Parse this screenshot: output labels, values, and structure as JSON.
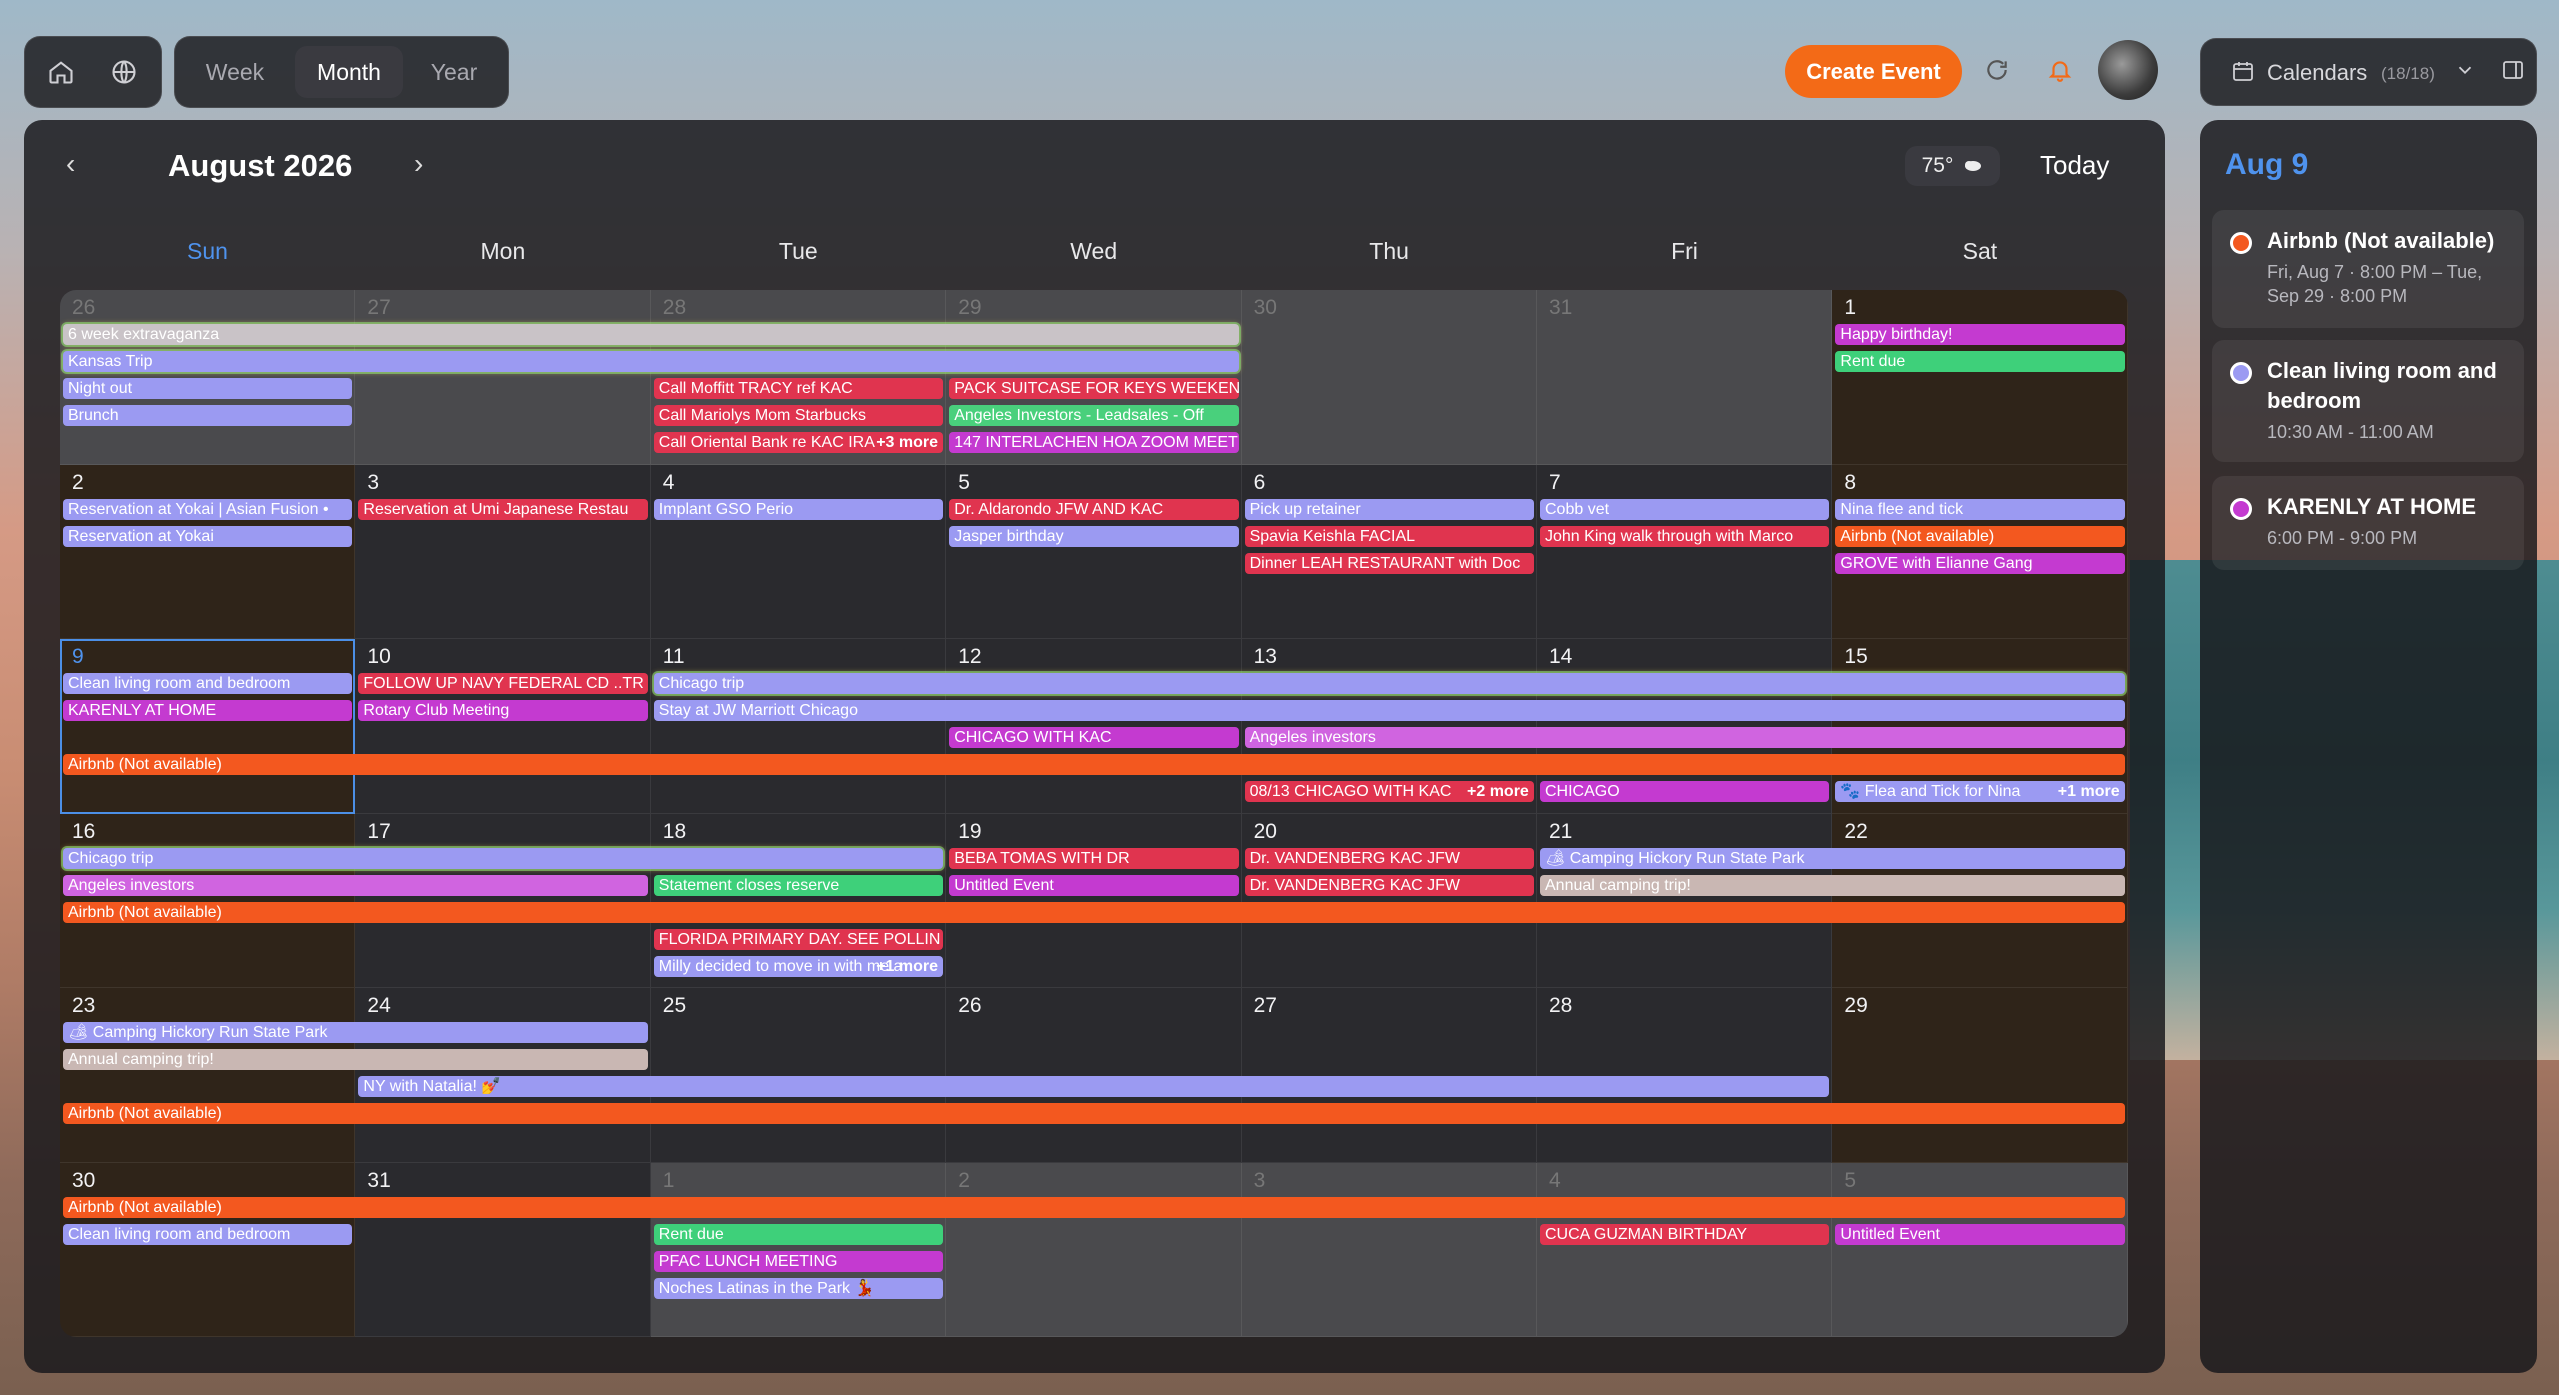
{
  "toolbar": {
    "views": [
      "Week",
      "Month",
      "Year"
    ],
    "active_view": "Month",
    "create_label": "Create Event",
    "calendars_label": "Calendars",
    "calendars_count": "(18/18)"
  },
  "calendar": {
    "title": "August 2026",
    "weather": "75°",
    "today_label": "Today",
    "weekdays": [
      "Sun",
      "Mon",
      "Tue",
      "Wed",
      "Thu",
      "Fri",
      "Sat"
    ],
    "weeks": [
      [
        "26",
        "27",
        "28",
        "29",
        "30",
        "31",
        "1"
      ],
      [
        "2",
        "3",
        "4",
        "5",
        "6",
        "7",
        "8"
      ],
      [
        "9",
        "10",
        "11",
        "12",
        "13",
        "14",
        "15"
      ],
      [
        "16",
        "17",
        "18",
        "19",
        "20",
        "21",
        "22"
      ],
      [
        "23",
        "24",
        "25",
        "26",
        "27",
        "28",
        "29"
      ],
      [
        "30",
        "31",
        "1",
        "2",
        "3",
        "4",
        "5"
      ]
    ],
    "events": [
      {
        "w": 0,
        "c": 0,
        "span": 4,
        "row": 0,
        "text": "6 week extravaganza",
        "color": "#c9c3c7",
        "glow": true
      },
      {
        "w": 0,
        "c": 0,
        "span": 4,
        "row": 1,
        "text": "Kansas Trip",
        "color": "#9b9af2",
        "glow": true
      },
      {
        "w": 0,
        "c": 0,
        "span": 1,
        "row": 2,
        "text": "Night out",
        "color": "#9b9af2"
      },
      {
        "w": 0,
        "c": 0,
        "span": 1,
        "row": 3,
        "text": "Brunch",
        "color": "#9b9af2"
      },
      {
        "w": 0,
        "c": 2,
        "span": 1,
        "row": 2,
        "text": "Call Moffitt TRACY ref KAC",
        "color": "#e0344f"
      },
      {
        "w": 0,
        "c": 2,
        "span": 1,
        "row": 3,
        "text": "Call Mariolys Mom Starbucks",
        "color": "#e0344f"
      },
      {
        "w": 0,
        "c": 2,
        "span": 1,
        "row": 4,
        "text": "Call Oriental Bank re KAC IRA",
        "color": "#e0344f"
      },
      {
        "w": 0,
        "c": 3,
        "span": 1,
        "row": 2,
        "text": "PACK SUITCASE FOR KEYS WEEKEN",
        "color": "#e0344f"
      },
      {
        "w": 0,
        "c": 3,
        "span": 1,
        "row": 3,
        "text": "Angeles Investors - Leadsales - Off",
        "color": "#49d07c"
      },
      {
        "w": 0,
        "c": 3,
        "span": 1,
        "row": 4,
        "text": "147 INTERLACHEN HOA ZOOM MEET",
        "color": "#c43ad0"
      },
      {
        "w": 0,
        "c": 6,
        "span": 1,
        "row": 0,
        "text": "Happy birthday!",
        "color": "#c43ad0"
      },
      {
        "w": 0,
        "c": 6,
        "span": 1,
        "row": 1,
        "text": "Rent due",
        "color": "#3ed07a"
      },
      {
        "w": 1,
        "c": 0,
        "span": 1,
        "row": 0,
        "text": "Reservation at Yokai | Asian Fusion •",
        "color": "#9b9af2"
      },
      {
        "w": 1,
        "c": 0,
        "span": 1,
        "row": 1,
        "text": "Reservation at Yokai",
        "color": "#9b9af2"
      },
      {
        "w": 1,
        "c": 1,
        "span": 1,
        "row": 0,
        "text": "Reservation at Umi Japanese Restau",
        "color": "#e0344f"
      },
      {
        "w": 1,
        "c": 2,
        "span": 1,
        "row": 0,
        "text": "Implant GSO Perio",
        "color": "#9b9af2"
      },
      {
        "w": 1,
        "c": 3,
        "span": 1,
        "row": 0,
        "text": "Dr. Aldarondo JFW AND KAC",
        "color": "#e0344f"
      },
      {
        "w": 1,
        "c": 3,
        "span": 1,
        "row": 1,
        "text": "Jasper birthday",
        "color": "#9b9af2"
      },
      {
        "w": 1,
        "c": 4,
        "span": 1,
        "row": 0,
        "text": "Pick up retainer",
        "color": "#9b9af2"
      },
      {
        "w": 1,
        "c": 4,
        "span": 1,
        "row": 1,
        "text": "Spavia Keishla FACIAL",
        "color": "#e0344f"
      },
      {
        "w": 1,
        "c": 4,
        "span": 1,
        "row": 2,
        "text": "Dinner LEAH RESTAURANT with Doc",
        "color": "#e0344f"
      },
      {
        "w": 1,
        "c": 5,
        "span": 1,
        "row": 0,
        "text": "Cobb vet",
        "color": "#9b9af2"
      },
      {
        "w": 1,
        "c": 5,
        "span": 1,
        "row": 1,
        "text": "John King walk through with Marco",
        "color": "#e0344f"
      },
      {
        "w": 1,
        "c": 6,
        "span": 1,
        "row": 0,
        "text": "Nina flee and tick",
        "color": "#9b9af2"
      },
      {
        "w": 1,
        "c": 6,
        "span": 1,
        "row": 1,
        "text": "Airbnb (Not available)",
        "color": "#f3581f"
      },
      {
        "w": 1,
        "c": 6,
        "span": 1,
        "row": 2,
        "text": "GROVE with Elianne Gang",
        "color": "#c43ad0"
      },
      {
        "w": 2,
        "c": 0,
        "span": 1,
        "row": 0,
        "text": "Clean living room and bedroom",
        "color": "#9b9af2"
      },
      {
        "w": 2,
        "c": 0,
        "span": 1,
        "row": 1,
        "text": "KARENLY AT HOME",
        "color": "#c43ad0"
      },
      {
        "w": 2,
        "c": 0,
        "span": 7,
        "row": 3,
        "text": "Airbnb (Not available)",
        "color": "#f3581f"
      },
      {
        "w": 2,
        "c": 1,
        "span": 1,
        "row": 0,
        "text": "FOLLOW UP NAVY FEDERAL CD ..TR",
        "color": "#e0344f"
      },
      {
        "w": 2,
        "c": 1,
        "span": 1,
        "row": 1,
        "text": "Rotary Club Meeting",
        "color": "#c43ad0"
      },
      {
        "w": 2,
        "c": 2,
        "span": 5,
        "row": 0,
        "text": "Chicago trip",
        "color": "#9b9af2",
        "glow": true
      },
      {
        "w": 2,
        "c": 2,
        "span": 5,
        "row": 1,
        "text": "Stay at JW Marriott Chicago",
        "color": "#9b9af2"
      },
      {
        "w": 2,
        "c": 3,
        "span": 1,
        "row": 2,
        "text": "CHICAGO WITH KAC",
        "color": "#c43ad0"
      },
      {
        "w": 2,
        "c": 4,
        "span": 3,
        "row": 2,
        "text": "Angeles investors",
        "color": "#d064e0"
      },
      {
        "w": 2,
        "c": 4,
        "span": 1,
        "row": 4,
        "text": "08/13 CHICAGO WITH KAC",
        "color": "#e0344f"
      },
      {
        "w": 2,
        "c": 5,
        "span": 1,
        "row": 4,
        "text": "CHICAGO",
        "color": "#c43ad0"
      },
      {
        "w": 2,
        "c": 6,
        "span": 1,
        "row": 4,
        "text": "🐾 Flea and Tick for Nina",
        "color": "#9b9af2"
      },
      {
        "w": 3,
        "c": 0,
        "span": 3,
        "row": 0,
        "text": "Chicago trip",
        "color": "#9b9af2",
        "glow": true
      },
      {
        "w": 3,
        "c": 0,
        "span": 2,
        "row": 1,
        "text": "Angeles investors",
        "color": "#d064e0"
      },
      {
        "w": 3,
        "c": 0,
        "span": 7,
        "row": 2,
        "text": "Airbnb (Not available)",
        "color": "#f3581f"
      },
      {
        "w": 3,
        "c": 2,
        "span": 1,
        "row": 1,
        "text": "Statement closes reserve",
        "color": "#3ed07a"
      },
      {
        "w": 3,
        "c": 2,
        "span": 1,
        "row": 3,
        "text": "FLORIDA PRIMARY DAY. SEE POLLIN",
        "color": "#e0344f"
      },
      {
        "w": 3,
        "c": 2,
        "span": 1,
        "row": 4,
        "text": "Milly decided to move in with me a",
        "color": "#9b9af2"
      },
      {
        "w": 3,
        "c": 3,
        "span": 1,
        "row": 0,
        "text": "BEBA TOMAS WITH DR",
        "color": "#e0344f"
      },
      {
        "w": 3,
        "c": 3,
        "span": 1,
        "row": 1,
        "text": "Untitled Event",
        "color": "#c43ad0"
      },
      {
        "w": 3,
        "c": 4,
        "span": 1,
        "row": 0,
        "text": "Dr. VANDENBERG KAC JFW",
        "color": "#e0344f"
      },
      {
        "w": 3,
        "c": 4,
        "span": 1,
        "row": 1,
        "text": "Dr. VANDENBERG KAC JFW",
        "color": "#e0344f"
      },
      {
        "w": 3,
        "c": 5,
        "span": 2,
        "row": 0,
        "text": "🏕 Camping Hickory Run State Park",
        "color": "#9b9af2"
      },
      {
        "w": 3,
        "c": 5,
        "span": 2,
        "row": 1,
        "text": "Annual camping trip!",
        "color": "#c9b7b3"
      },
      {
        "w": 4,
        "c": 0,
        "span": 2,
        "row": 0,
        "text": "🏕 Camping Hickory Run State Park",
        "color": "#9b9af2"
      },
      {
        "w": 4,
        "c": 0,
        "span": 2,
        "row": 1,
        "text": "Annual camping trip!",
        "color": "#c9b7b3"
      },
      {
        "w": 4,
        "c": 1,
        "span": 5,
        "row": 2,
        "text": "NY with Natalia! 💅",
        "color": "#9b9af2"
      },
      {
        "w": 4,
        "c": 0,
        "span": 7,
        "row": 3,
        "text": "Airbnb (Not available)",
        "color": "#f3581f"
      },
      {
        "w": 5,
        "c": 0,
        "span": 7,
        "row": 0,
        "text": "Airbnb (Not available)",
        "color": "#f3581f"
      },
      {
        "w": 5,
        "c": 0,
        "span": 1,
        "row": 1,
        "text": "Clean living room and bedroom",
        "color": "#9b9af2"
      },
      {
        "w": 5,
        "c": 2,
        "span": 1,
        "row": 1,
        "text": "Rent due",
        "color": "#3ed07a"
      },
      {
        "w": 5,
        "c": 2,
        "span": 1,
        "row": 2,
        "text": "PFAC LUNCH MEETING",
        "color": "#c43ad0"
      },
      {
        "w": 5,
        "c": 2,
        "span": 1,
        "row": 3,
        "text": "Noches Latinas in the Park 💃",
        "color": "#9b9af2"
      },
      {
        "w": 5,
        "c": 5,
        "span": 1,
        "row": 1,
        "text": "CUCA GUZMAN BIRTHDAY",
        "color": "#e0344f"
      },
      {
        "w": 5,
        "c": 6,
        "span": 1,
        "row": 1,
        "text": "Untitled Event",
        "color": "#c43ad0"
      }
    ],
    "more": [
      {
        "w": 0,
        "c": 2,
        "row": 4,
        "text": "+3 more"
      },
      {
        "w": 2,
        "c": 4,
        "row": 4,
        "text": "+2 more"
      },
      {
        "w": 2,
        "c": 6,
        "row": 4,
        "text": "+1 more"
      },
      {
        "w": 3,
        "c": 2,
        "row": 4,
        "text": "+1 more"
      }
    ]
  },
  "sidebar": {
    "date": "Aug 9",
    "events": [
      {
        "title": "Airbnb (Not available)",
        "time": "Fri, Aug 7 · 8:00 PM – Tue, Sep 29 · 8:00 PM",
        "color": "#f3581f"
      },
      {
        "title": "Clean living room and bedroom",
        "time": "10:30 AM - 11:00 AM",
        "color": "#9b9af2"
      },
      {
        "title": "KARENLY AT HOME",
        "time": "6:00 PM - 9:00 PM",
        "color": "#c43ad0"
      }
    ]
  }
}
